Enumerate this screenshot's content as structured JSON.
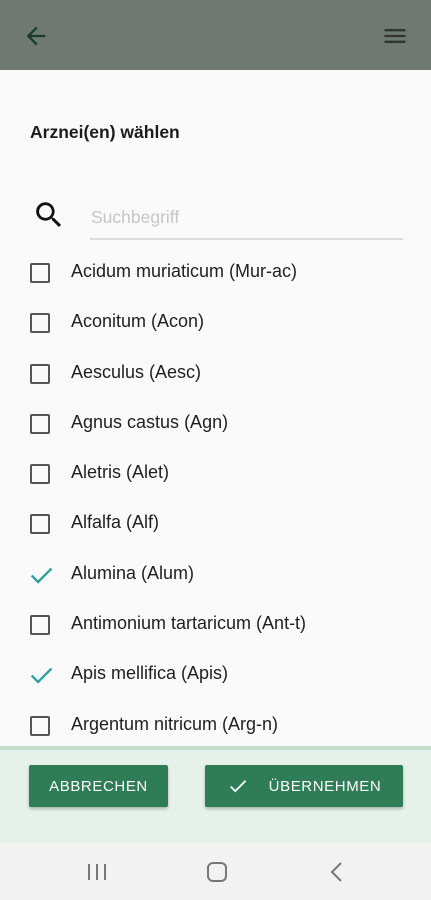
{
  "app_bar": {
    "back_icon": "arrow-left-icon",
    "menu_icon": "hamburger-menu-icon"
  },
  "dialog": {
    "title": "Arznei(en) wählen",
    "search": {
      "icon": "search-icon",
      "placeholder": "Suchbegriff",
      "value": ""
    },
    "items": [
      {
        "label": "Acidum muriaticum (Mur-ac)",
        "checked": false
      },
      {
        "label": "Aconitum (Acon)",
        "checked": false
      },
      {
        "label": "Aesculus (Aesc)",
        "checked": false
      },
      {
        "label": "Agnus castus (Agn)",
        "checked": false
      },
      {
        "label": "Aletris (Alet)",
        "checked": false
      },
      {
        "label": "Alfalfa (Alf)",
        "checked": false
      },
      {
        "label": "Alumina (Alum)",
        "checked": true
      },
      {
        "label": "Antimonium tartaricum (Ant-t)",
        "checked": false
      },
      {
        "label": "Apis mellifica (Apis)",
        "checked": true
      },
      {
        "label": "Argentum nitricum (Arg-n)",
        "checked": false
      }
    ],
    "buttons": {
      "cancel_label": "ABBRECHEN",
      "apply_label": "ÜBERNEHMEN",
      "apply_icon": "check-icon"
    }
  },
  "nav_bar": {
    "recent_icon": "recent-apps-icon",
    "home_icon": "home-icon",
    "back_icon": "nav-back-icon"
  },
  "colors": {
    "app_bar": "#6f7972",
    "primary_button": "#2e7d57",
    "checkmark": "#2aa198",
    "footer_bg": "#e6f1ea"
  }
}
